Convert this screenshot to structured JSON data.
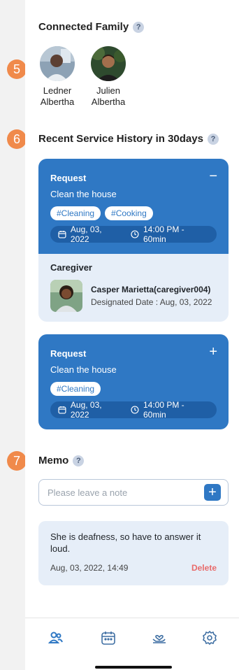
{
  "family": {
    "title": "Connected Family",
    "help": "?",
    "step": "5",
    "members": [
      {
        "first": "Ledner",
        "last": "Albertha"
      },
      {
        "first": "Julien",
        "last": "Albertha"
      }
    ]
  },
  "history": {
    "title": "Recent Service History in 30days",
    "help": "?",
    "step": "6",
    "cards": [
      {
        "label": "Request",
        "task": "Clean the house",
        "tags": [
          "#Cleaning",
          "#Cooking"
        ],
        "date": "Aug, 03, 2022",
        "time": "14:00 PM - 60min",
        "toggle": "−",
        "caregiver": {
          "label": "Caregiver",
          "name": "Casper Marietta(caregiver004)",
          "designated": "Designated Date : Aug, 03, 2022"
        }
      },
      {
        "label": "Request",
        "task": "Clean the house",
        "tags": [
          "#Cleaning"
        ],
        "date": "Aug, 03, 2022",
        "time": "14:00 PM - 60min",
        "toggle": "+"
      }
    ]
  },
  "memo": {
    "title": "Memo",
    "help": "?",
    "step": "7",
    "placeholder": "Please leave a note",
    "add": "+",
    "entry": {
      "text": "She is deafness, so have to answer it loud.",
      "timestamp": "Aug, 03, 2022, 14:49",
      "delete": "Delete"
    }
  },
  "tabbar": {
    "icons": [
      "family-icon",
      "calendar-icon",
      "care-icon",
      "gear-icon"
    ],
    "active_color": "#2f78c4",
    "inactive_color": "#3f6fa3"
  },
  "colors": {
    "primary": "#2f78c4",
    "step": "#f08a4b",
    "danger": "#e86b6b"
  }
}
